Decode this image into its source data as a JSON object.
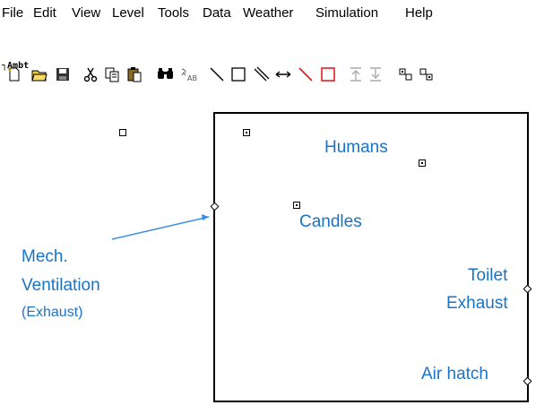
{
  "menu": [
    "File",
    "Edit",
    "View",
    "Level",
    "Tools",
    "Data",
    "Weather",
    "Simulation",
    "Help"
  ],
  "toolbar": {
    "icons": [
      "new-file-icon",
      "open-folder-icon",
      "save-icon",
      "cut-icon",
      "copy-icon",
      "paste-icon",
      "find-icon",
      "replace-icon",
      "draw-line-icon",
      "draw-rect-icon",
      "draw-double-line-icon",
      "draw-arrow-icon",
      "red-line-icon",
      "red-rect-icon",
      "move-up-icon",
      "move-down-icon",
      "zoom-region-icon",
      "zoom-region-2-icon"
    ]
  },
  "status": {
    "text": "Ambt"
  },
  "annotations": {
    "humans": "Humans",
    "candles": "Candles",
    "mech_line1": "Mech.",
    "mech_line2": "Ventilation",
    "mech_line3": "(Exhaust)",
    "toilet_line1": "Toilet",
    "toilet_line2": "Exhaust",
    "air_hatch": "Air hatch"
  },
  "colors": {
    "annotation": "#1a73c7",
    "arrow": "#3b8ee6",
    "red_tool": "#e02020"
  }
}
